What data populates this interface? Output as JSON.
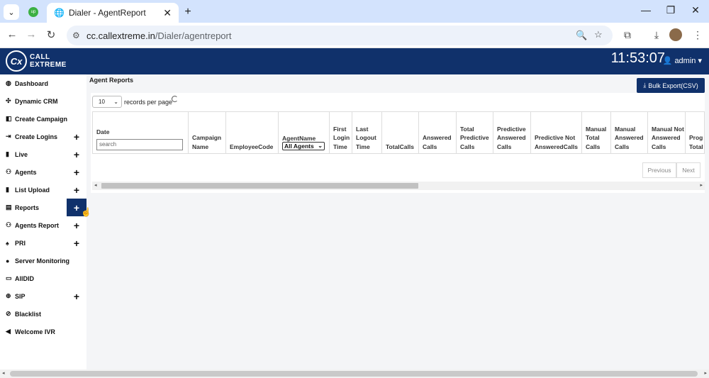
{
  "browser": {
    "tab_title": "Dialer - AgentReport",
    "url_domain": "cc.callextreme.in",
    "url_path": "/Dialer/agentreport"
  },
  "app": {
    "logo_line1": "CALL",
    "logo_line2": "EXTREME",
    "logo_mark": "Cx",
    "clock": "11:53:07",
    "user": "admin"
  },
  "sidebar": {
    "items": [
      {
        "label": "Dashboard",
        "icon": "dashboard-icon",
        "expandable": false
      },
      {
        "label": "Dynamic CRM",
        "icon": "arrows-icon",
        "expandable": false
      },
      {
        "label": "Create Campaign",
        "icon": "campaign-icon",
        "expandable": false
      },
      {
        "label": "Create Logins",
        "icon": "login-icon",
        "expandable": true
      },
      {
        "label": "Live",
        "icon": "file-icon",
        "expandable": true
      },
      {
        "label": "Agents",
        "icon": "users-icon",
        "expandable": true
      },
      {
        "label": "List Upload",
        "icon": "file-icon",
        "expandable": true
      },
      {
        "label": "Reports",
        "icon": "report-icon",
        "expandable": true,
        "active": true
      },
      {
        "label": "Agents Report",
        "icon": "users-icon",
        "expandable": true
      },
      {
        "label": "PRI",
        "icon": "bell-icon",
        "expandable": true
      },
      {
        "label": "Server Monitoring",
        "icon": "info-icon",
        "expandable": false
      },
      {
        "label": "AllDID",
        "icon": "laptop-icon",
        "expandable": false
      },
      {
        "label": "SIP",
        "icon": "globe-icon",
        "expandable": true
      },
      {
        "label": "Blacklist",
        "icon": "ban-icon",
        "expandable": false
      },
      {
        "label": "Welcome IVR",
        "icon": "speaker-icon",
        "expandable": false
      }
    ]
  },
  "main": {
    "heading": "Agent Reports",
    "bulk_export": "Bulk Export(CSV)",
    "page_length": "10",
    "records_label": "records per page",
    "date_search_placeholder": "search",
    "agent_filter": "All Agents",
    "columns": [
      "Date",
      "Campaign Name",
      "EmployeeCode",
      "AgentName",
      "First Login Time",
      "Last Logout Time",
      "TotalCalls",
      "Answered Calls",
      "Total Predictive Calls",
      "Predictive Answered Calls",
      "Predictive Not AnsweredCalls",
      "Manual Total Calls",
      "Manual Answered Calls",
      "Manual Not Answered Calls",
      "Prog Total"
    ],
    "pager": {
      "previous": "Previous",
      "next": "Next"
    }
  },
  "colors": {
    "brand_navy": "#10316b",
    "chrome_tab_bar": "#d3e3fd",
    "content_bg": "#f4f5f7"
  }
}
